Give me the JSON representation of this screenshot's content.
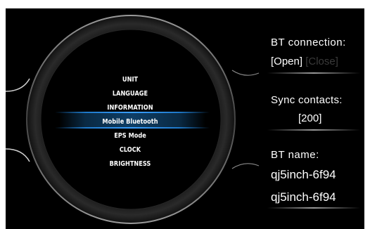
{
  "menu": {
    "items": [
      "UNIT",
      "LANGUAGE",
      "INFORMATION",
      "Mobile Bluetooth",
      "EPS Mode",
      "CLOCK",
      "BRIGHTNESS"
    ],
    "selected_index": 3
  },
  "bt_connection": {
    "label": "BT connection:",
    "open": "[Open]",
    "close": "[Close]",
    "selected": "Open"
  },
  "sync_contacts": {
    "label": "Sync contacts:",
    "value": "[200]"
  },
  "bt_name": {
    "label": "BT name:",
    "value_1": "qj5inch-6f94",
    "value_2": "qj5inch-6f94"
  },
  "colors": {
    "background": "#000000",
    "accent_blue": "#3ba0ff",
    "dial_ring": "#1c1c1c",
    "disabled_text": "#3a3a3a"
  }
}
